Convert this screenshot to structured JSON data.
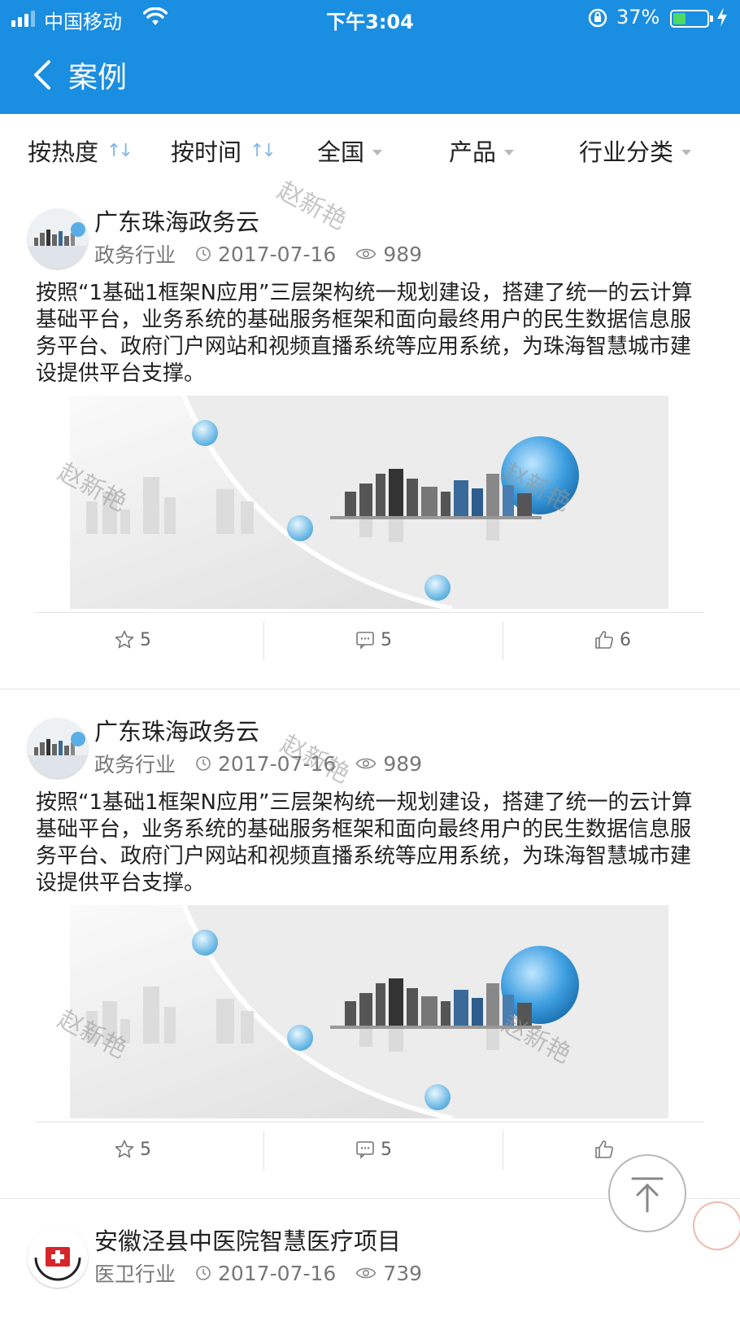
{
  "status_bar": {
    "carrier": "中国移动",
    "time": "下午3:04",
    "battery_percent": "37%",
    "battery_level": 0.37
  },
  "nav": {
    "title": "案例"
  },
  "filters": [
    {
      "label": "按热度",
      "kind": "sort"
    },
    {
      "label": "按时间",
      "kind": "sort"
    },
    {
      "label": "全国",
      "kind": "dropdown"
    },
    {
      "label": "产品",
      "kind": "dropdown"
    },
    {
      "label": "行业分类",
      "kind": "dropdown"
    }
  ],
  "cases": [
    {
      "title": "广东珠海政务云",
      "industry": "政务行业",
      "date": "2017-07-16",
      "views": "989",
      "description": "按照“1基础1框架N应用”三层架构统一规划建设，搭建了统一的云计算基础平台，业务系统的基础服务框架和面向最终用户的民生数据信息服务平台、政府门户网站和视频直播系统等应用系统，为珠海智慧城市建设提供平台支撑。",
      "favorites": "5",
      "comments": "5",
      "likes": "6"
    },
    {
      "title": "广东珠海政务云",
      "industry": "政务行业",
      "date": "2017-07-16",
      "views": "989",
      "description": "按照“1基础1框架N应用”三层架构统一规划建设，搭建了统一的云计算基础平台，业务系统的基础服务框架和面向最终用户的民生数据信息服务平台、政府门户网站和视频直播系统等应用系统，为珠海智慧城市建设提供平台支撑。",
      "favorites": "5",
      "comments": "5",
      "likes": ""
    },
    {
      "title": "安徽泾县中医院智慧医疗项目",
      "industry": "医卫行业",
      "date": "2017-07-16",
      "views": "739"
    }
  ],
  "watermark_text": "赵新艳",
  "colors": {
    "nav_bg": "#1a8ee0",
    "sort_icon": "#7fb6e8",
    "meta_text": "#777777"
  }
}
